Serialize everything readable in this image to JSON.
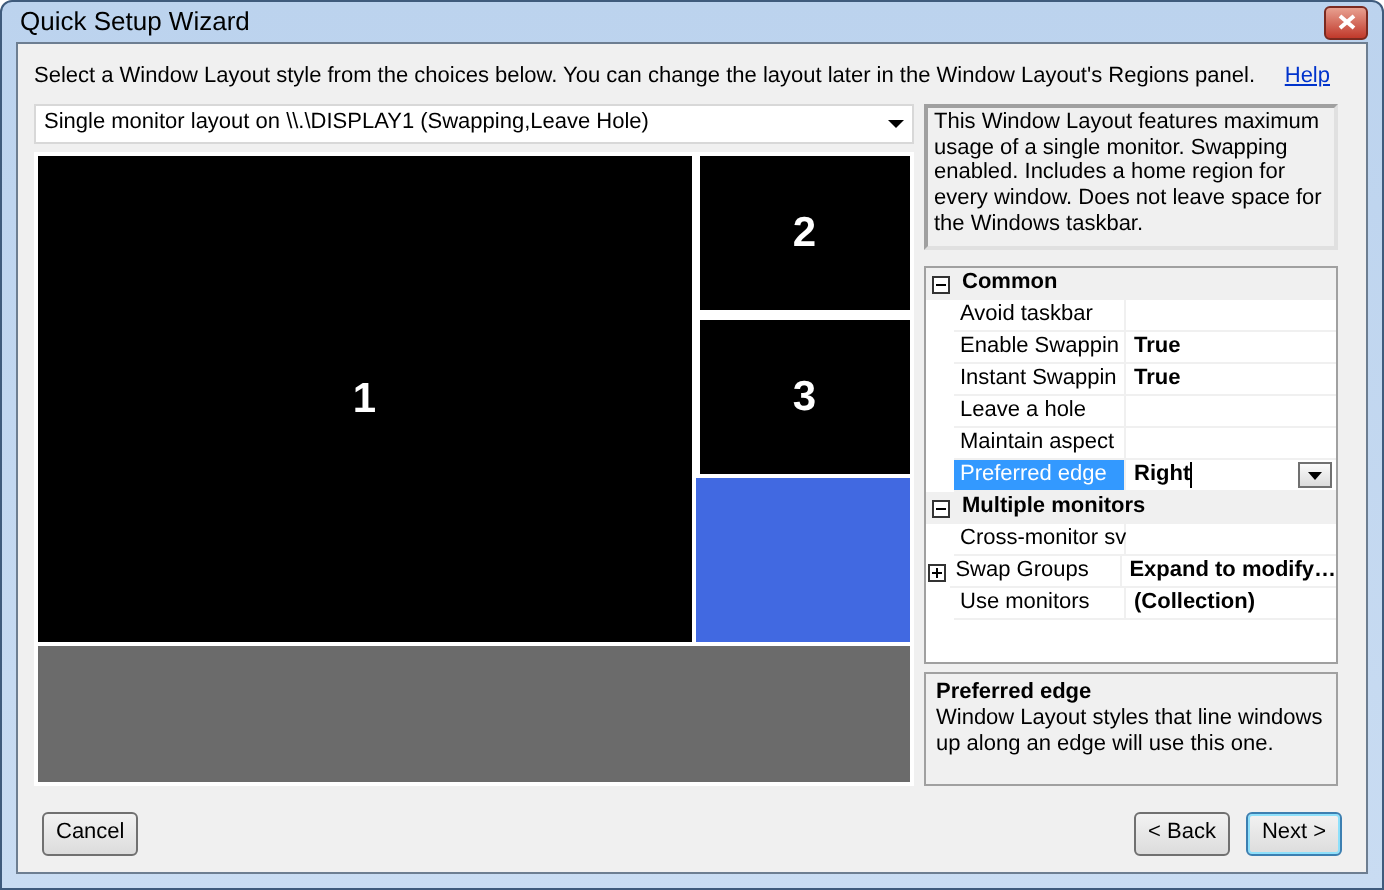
{
  "window": {
    "title": "Quick Setup Wizard"
  },
  "instruction": "Select a Window Layout style from the choices below. You can change the layout later in the Window Layout's Regions panel.",
  "help_link": "Help",
  "layout_select": {
    "value": "Single monitor layout on \\\\.\\DISPLAY1 (Swapping,Leave Hole)"
  },
  "description": "This Window Layout features maximum usage of a single monitor. Swapping enabled. Includes a home region for every window. Does not leave space for the Windows taskbar.",
  "preview": {
    "regions": [
      {
        "kind": "numbered",
        "label": "1",
        "color": "#000000"
      },
      {
        "kind": "numbered",
        "label": "2",
        "color": "#000000"
      },
      {
        "kind": "numbered",
        "label": "3",
        "color": "#000000"
      },
      {
        "kind": "blank",
        "color": "#4169e1"
      },
      {
        "kind": "hole",
        "color": "#6b6b6b"
      }
    ]
  },
  "properties": [
    {
      "kind": "category",
      "name": "Common",
      "expanded": true
    },
    {
      "kind": "property",
      "name": "Avoid taskbar",
      "selected": false
    },
    {
      "kind": "property",
      "name": "Enable Swappin",
      "value": "True",
      "selected": false
    },
    {
      "kind": "property",
      "name": "Instant Swappin",
      "value": "True",
      "selected": false
    },
    {
      "kind": "property",
      "name": "Leave a hole",
      "selected": false
    },
    {
      "kind": "property",
      "name": "Maintain aspect",
      "selected": false
    },
    {
      "kind": "property",
      "name": "Preferred edge",
      "value": "Right",
      "selected": true
    },
    {
      "kind": "category",
      "name": "Multiple monitors",
      "expanded": true
    },
    {
      "kind": "property",
      "name": "Cross-monitor sv",
      "selected": false
    },
    {
      "kind": "property",
      "name": "Swap Groups",
      "value": "Expand to modify…",
      "selected": false,
      "expanded": false
    },
    {
      "kind": "property",
      "name": "Use monitors",
      "value": "(Collection)",
      "selected": false
    }
  ],
  "property_help": {
    "title": "Preferred edge",
    "text": "Window Layout styles that line windows up along an edge will use this one."
  },
  "buttons": [
    {
      "label": "Cancel",
      "default": false
    },
    {
      "label": "< Back",
      "default": false
    },
    {
      "label": "Next >",
      "default": true
    }
  ]
}
